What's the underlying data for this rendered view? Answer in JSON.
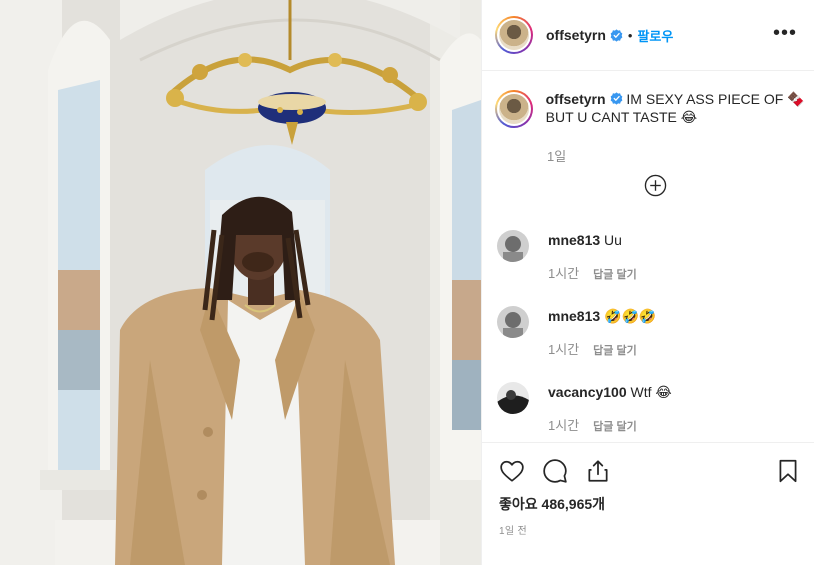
{
  "post": {
    "username": "offsetyrn",
    "follow_label": "팔로우",
    "dot": "•",
    "more_label": "•••",
    "caption_text": "IM SEXY ASS PIECE OF 🍫 BUT U CANT TASTE 😂",
    "caption_time": "1일",
    "likes_label": "좋아요 486,965개",
    "posted_time": "1일 전"
  },
  "comments": [
    {
      "user": "mne813",
      "text": "Uu",
      "time": "1시간",
      "reply": "답글 달기"
    },
    {
      "user": "mne813",
      "text": "🤣🤣🤣",
      "time": "1시간",
      "reply": "답글 달기"
    },
    {
      "user": "vacancy100",
      "text": "Wtf 😂",
      "time": "1시간",
      "reply": "답글 달기"
    }
  ],
  "icons": {
    "like": "heart-icon",
    "comment": "comment-icon",
    "share": "share-icon",
    "save": "bookmark-icon",
    "verified": "verified-badge-icon",
    "load_more": "plus-circle-icon"
  },
  "colors": {
    "link": "#0095f6",
    "verified": "#3897f0",
    "muted": "#8e8e8e",
    "text": "#262626"
  }
}
